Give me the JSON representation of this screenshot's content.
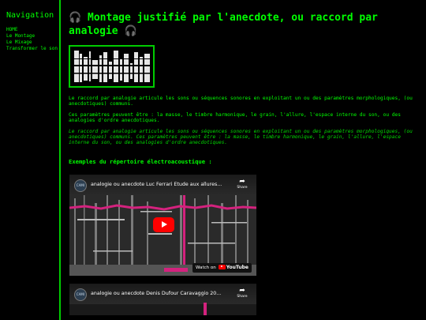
{
  "sidebar": {
    "heading": "Navigation",
    "items": [
      {
        "label": "HOME"
      },
      {
        "label": "Le Montage"
      },
      {
        "label": "Le Mixage"
      },
      {
        "label": "Transformer le son"
      }
    ]
  },
  "main": {
    "title": "Montage justifié par l'anecdote, ou raccord par analogie",
    "icons": {
      "headphones": "headphones-icon"
    },
    "paragraph1": "Le raccord par analogie articule les sons ou séquences sonores en exploitant un ou des paramètres morphologiques, (ou anecdotiques) communs.",
    "paragraph2": "Ces paramètres peuvent être : la masse, le timbre harmonique, le grain, l'allure, l'espace interne du son, ou des analogies d'ordre anecdotiques.",
    "paragraph3": "Le raccord par analogie articule les sons ou séquences sonores en exploitant un ou des paramètres morphologiques, (ou anecdotiques) communs. Ces paramètres peuvent être : la masse, le timbre harmonique, le grain, l'allure, l'espace interne du son, ou des analogies d'ordre anecdotiques.",
    "examples_heading": "Exemples du répertoire électroacoustique :"
  },
  "videos": [
    {
      "title": "analogie ou anecdote Luc Ferrari Etude aux allures...",
      "share_label": "Share",
      "watch_label": "Watch on",
      "youtube_label": "YouTube",
      "channel_abbr": "CAMI"
    },
    {
      "title": "analogie ou anecdote Denis Dufour Caravaggio 20...",
      "share_label": "Share",
      "channel_abbr": "CAMI"
    }
  ],
  "colors": {
    "accent": "#00ff00",
    "background": "#000000",
    "play": "#ff0000",
    "spectrum": "#d4227e"
  }
}
